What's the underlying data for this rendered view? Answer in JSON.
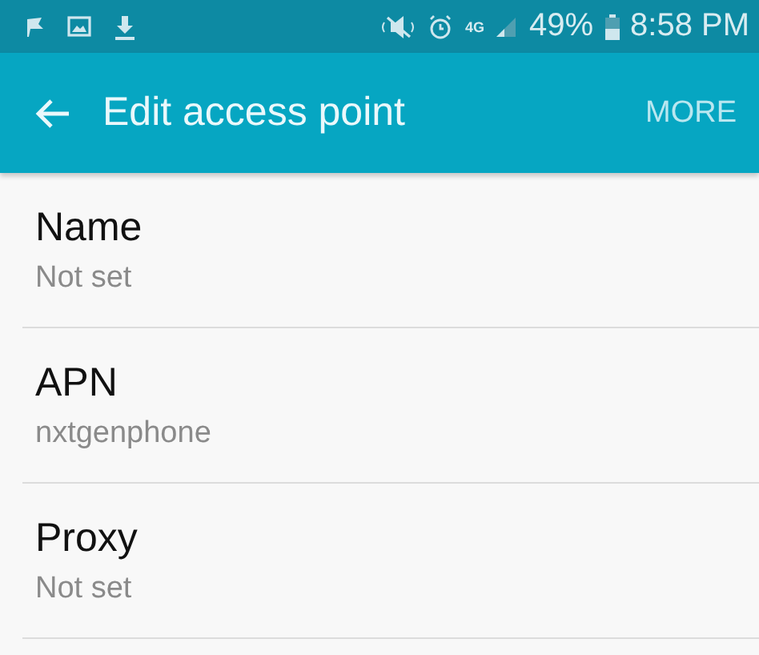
{
  "status_bar": {
    "network": "4G",
    "battery": "49%",
    "time": "8:58 PM"
  },
  "app_bar": {
    "title": "Edit access point",
    "action": "MORE"
  },
  "settings": [
    {
      "title": "Name",
      "value": "Not set"
    },
    {
      "title": "APN",
      "value": "nxtgenphone"
    },
    {
      "title": "Proxy",
      "value": "Not set"
    }
  ]
}
